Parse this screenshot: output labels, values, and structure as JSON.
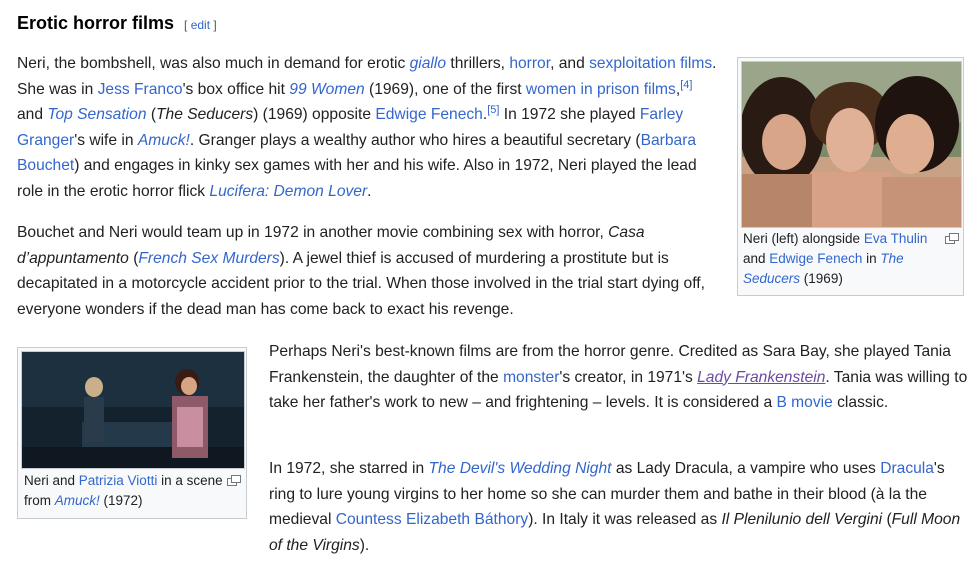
{
  "section": {
    "title": "Erotic horror films",
    "edit_open": "[ ",
    "edit_label": "edit",
    "edit_close": " ]"
  },
  "p1": {
    "t1": "Neri, the bombshell, was also much in demand for erotic ",
    "l_giallo": "giallo",
    "t2": " thrillers, ",
    "l_horror": "horror",
    "t3": ", and ",
    "l_sexploitation": "sexploitation films",
    "t4": ". She was in ",
    "l_franco": "Jess Franco",
    "t5": "'s box office hit ",
    "l_99women": "99 Women",
    "t6": " (1969), one of the first ",
    "l_wip": "women in prison films",
    "t7": ",",
    "ref1": "[4]",
    "t8": " and ",
    "l_topsens": "Top Sensation",
    "t9": " (",
    "t9i": "The Seducers",
    "t10": ") (1969) opposite ",
    "l_fenech": "Edwige Fenech",
    "t11": ".",
    "ref2": "[5]",
    "t12": " In 1972 she played ",
    "l_granger": "Farley Granger",
    "t13": "'s wife in ",
    "l_amuck": "Amuck!",
    "t14": ". Granger plays a wealthy author who hires a beautiful secretary (",
    "l_bouchet": "Barbara Bouchet",
    "t15": ") and engages in kinky sex games with her and his wife. Also in 1972, Neri played the lead role in the erotic horror flick ",
    "l_lucifera": "Lucifera: Demon Lover",
    "t16": "."
  },
  "p2": {
    "t1": "Bouchet and Neri would team up in 1972 in another movie combining sex with horror, ",
    "t1i": "Casa d’appuntamento",
    "t2": " (",
    "l_fsm": "French Sex Murders",
    "t3": "). A jewel thief is accused of murdering a prostitute but is decapitated in a motorcycle accident prior to the trial. When those involved in the trial start dying off, everyone wonders if the dead man has come back to exact his revenge."
  },
  "p3": {
    "t1": "Perhaps Neri's best-known films are from the horror genre. Credited as Sara Bay, she played Tania Frankenstein, the daughter of the ",
    "l_monster": "monster",
    "t2": "'s creator, in 1971's ",
    "l_lady": "Lady Frankenstein",
    "t3": ". Tania was willing to take her father's work to new – and frightening – levels. It is considered a ",
    "l_bmovie": "B movie",
    "t4": " classic."
  },
  "p4": {
    "t1": "In 1972, she starred in ",
    "l_devils": "The Devil's Wedding Night",
    "t2": " as Lady Dracula, a vampire who uses ",
    "l_dracula": "Dracula",
    "t3": "'s ring to lure young virgins to her home so she can murder them and bathe in their blood (à la the medieval ",
    "l_bathory": "Countess Elizabeth Báthory",
    "t4": "). In Italy it was released as ",
    "t4i": "Il Plenilunio dell Vergini",
    "t5": " (",
    "t5i": "Full Moon of the Virgins",
    "t6": ")."
  },
  "thumb1": {
    "c1": "Neri (left) alongside ",
    "l_thulin": "Eva Thulin",
    "c2": " and ",
    "l_fenech": "Edwige Fenech",
    "c3": " in ",
    "l_seducers": "The Seducers",
    "c4": " (1969)"
  },
  "thumb2": {
    "c1": "Neri and ",
    "l_viotti": "Patrizia Viotti",
    "c2": " in a scene from ",
    "l_amuck": "Amuck!",
    "c3": " (1972)"
  },
  "icons": {
    "enlarge": "enlarge-icon"
  },
  "colors": {
    "link": "#3366cc",
    "visited_link": "#6b4ba1",
    "text": "#202122"
  }
}
